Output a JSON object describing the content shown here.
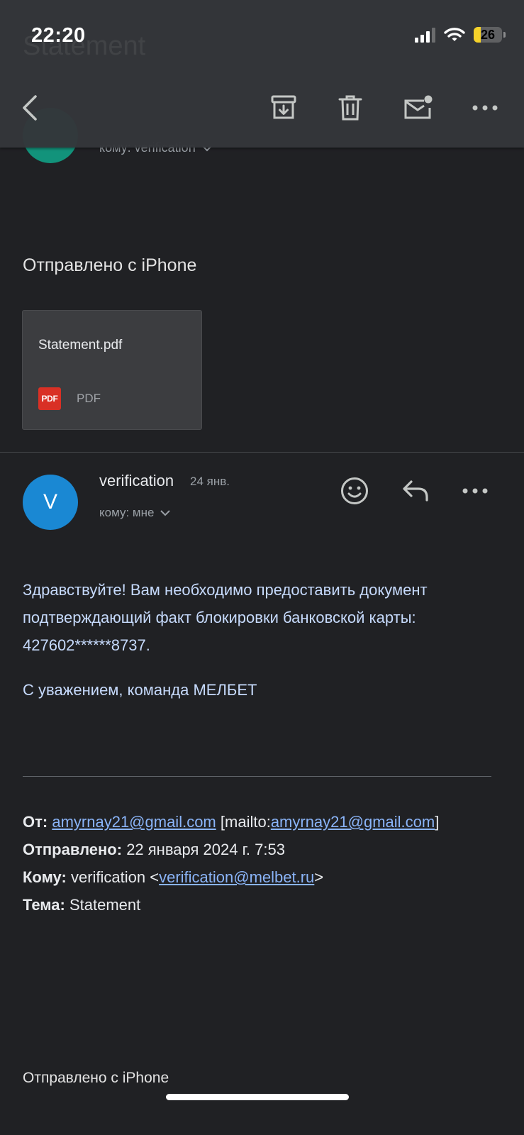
{
  "status_bar": {
    "time": "22:20",
    "battery_level": "26",
    "battery_fraction": 0.26
  },
  "header": {
    "ghost_subject": "Statement"
  },
  "toolbar": {
    "back_icon": "chevron-left-icon",
    "archive_icon": "archive-icon",
    "delete_icon": "trash-icon",
    "mark_unread_icon": "mark-unread-icon",
    "more_icon": "more-horizontal-icon"
  },
  "message_1": {
    "to_line": "кому: verification",
    "body_footer": "Отправлено с iPhone",
    "attachment": {
      "name": "Statement.pdf",
      "badge": "PDF",
      "type": "PDF"
    }
  },
  "message_2": {
    "avatar_letter": "V",
    "sender": "verification",
    "date": "24 янв.",
    "to_line": "кому: мне",
    "body_lines": [
      "Здравствуйте! Вам необходимо предоставить документ",
      "подтверждающий факт блокировки банковской карты:",
      "427602******8737."
    ],
    "signature": "С уважением, команда МЕЛБЕТ",
    "quoted": {
      "from_label": "От:",
      "from_email": "amyrnay21@gmail.com",
      "mailto_prefix": "[mailto:",
      "mailto_email": "amyrnay21@gmail.com",
      "mailto_suffix": "]",
      "sent_label": "Отправлено:",
      "sent_value": "22 января 2024 г. 7:53",
      "to_label": "Кому:",
      "to_name": "verification <",
      "to_email": "verification@melbet.ru",
      "to_suffix": ">",
      "subject_label": "Тема:",
      "subject_value": "Statement"
    },
    "footer": "Отправлено с iPhone"
  },
  "colors": {
    "background": "#202124",
    "toolbar": "#34363a",
    "body_text": "#c6dafc",
    "link": "#8ab4f8",
    "avatar_v": "#1a88d3",
    "avatar_a": "#12937b",
    "battery": "#f5d22a"
  }
}
